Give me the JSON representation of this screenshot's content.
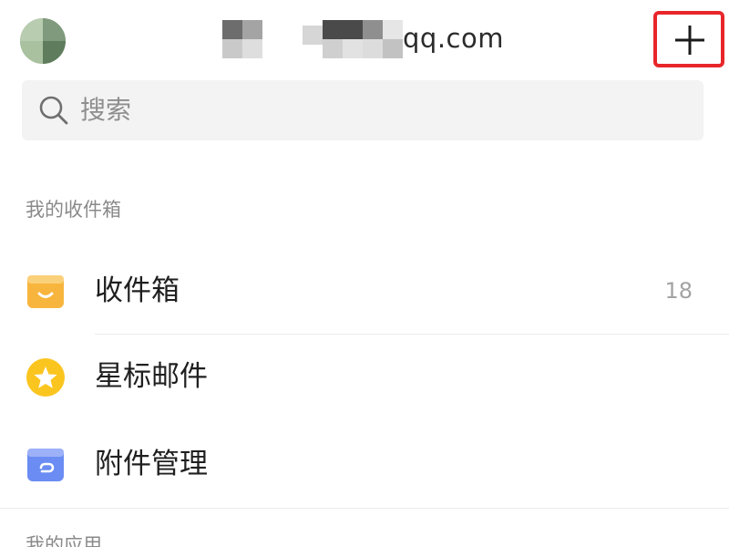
{
  "header": {
    "account_domain": "qq.com",
    "compose_symbol": "+",
    "compose_highlight_color": "#e8262a"
  },
  "search": {
    "placeholder": "搜索"
  },
  "sections": [
    {
      "title": "我的收件箱",
      "items": [
        {
          "label": "收件箱",
          "count": "18",
          "icon": "inbox-icon",
          "icon_color": "#f8b53d"
        },
        {
          "label": "星标邮件",
          "count": "",
          "icon": "star-icon",
          "icon_color": "#fbc520"
        },
        {
          "label": "附件管理",
          "count": "",
          "icon": "attachment-icon",
          "icon_color": "#6a8cf3"
        }
      ]
    },
    {
      "title": "我的应用",
      "items": []
    }
  ]
}
